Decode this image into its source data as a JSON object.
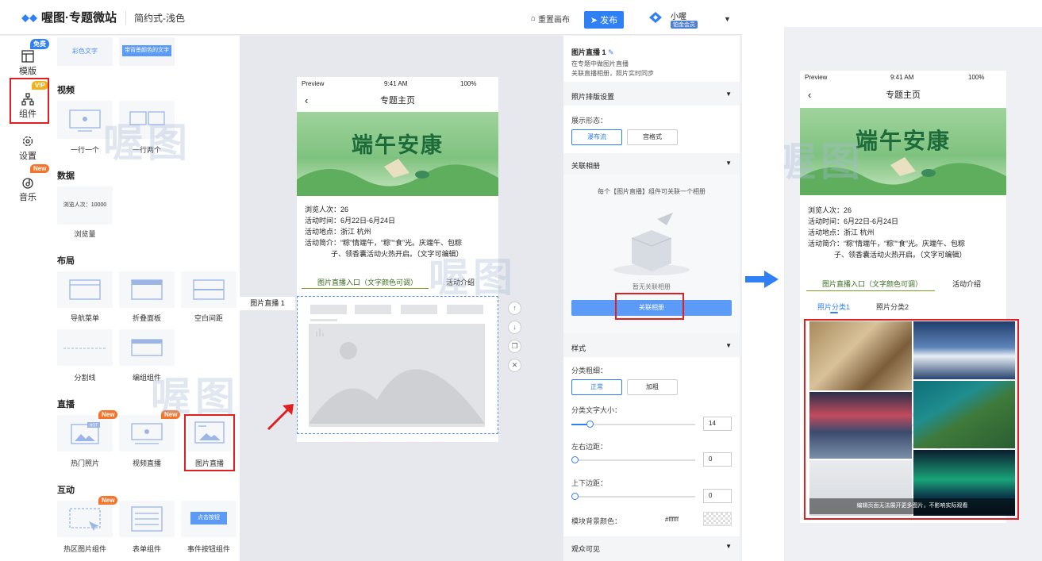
{
  "header": {
    "logo_text": "喔图·专题微站",
    "template_name": "简约式-浅色",
    "reset_label": "重置画布",
    "publish_label": "发布",
    "user_name": "小喔",
    "user_badge": "铂金会员"
  },
  "sidenav": {
    "items": [
      {
        "label": "模版",
        "badge": "免费",
        "badge_color": "#2f7ff5"
      },
      {
        "label": "组件",
        "badge": "VIP",
        "badge_color": "#f2b01e"
      },
      {
        "label": "设置",
        "badge": "",
        "badge_color": ""
      },
      {
        "label": "音乐",
        "badge": "New",
        "badge_color": "#f5742a"
      }
    ]
  },
  "components": {
    "top_cards": [
      "彩色文字",
      "带背景颜色的文字"
    ],
    "video": {
      "title": "视频",
      "items": [
        "一行一个",
        "一行两个"
      ]
    },
    "data": {
      "title": "数据",
      "items": [
        "浏览量"
      ],
      "card_text": "浏览人次：10000"
    },
    "layout": {
      "title": "布局",
      "items": [
        "导航菜单",
        "折叠面板",
        "空白间距",
        "分割线",
        "编组组件"
      ]
    },
    "live": {
      "title": "直播",
      "items": [
        "热门照片",
        "视频直播",
        "图片直播"
      ],
      "new_badge": "New",
      "hot_text": "HOT"
    },
    "interact": {
      "title": "互动",
      "items": [
        "热区图片组件",
        "表单组件",
        "事件按钮组件"
      ],
      "button_text": "点击按钮"
    }
  },
  "phone": {
    "status": {
      "carrier": "Preview",
      "time": "9:41 AM",
      "battery": "100%"
    },
    "title": "专题主页",
    "banner_title": "端午安康",
    "info": [
      "浏览人次：26",
      "活动时间：6月22日-6月24日",
      "活动地点：浙江 杭州",
      "活动简介：“粽”情端午，“粽”“食”光。庆端午、包粽",
      "子、领香囊活动火热开启。（文字可编辑）"
    ],
    "tabs": [
      "图片直播入口（文字颜色可调）",
      "活动介绍"
    ],
    "block_label": "图片直播 1"
  },
  "props": {
    "title": "图片直播 1",
    "desc1": "在专题中做图片直播",
    "desc2": "关联直播相册，照片实时同步",
    "sec_layout": "照片排版设置",
    "display_label": "展示形态：",
    "display_options": [
      "瀑布流",
      "宫格式"
    ],
    "sec_album": "关联相册",
    "album_hint": "每个【图片直播】组件可关联一个相册",
    "album_empty": "暂无关联相册",
    "album_button": "关联相册",
    "sec_style": "样式",
    "weight_label": "分类粗细：",
    "weight_options": [
      "正常",
      "加粗"
    ],
    "font_size_label": "分类文字大小：",
    "font_size_value": "14",
    "font_size_level": 0.15,
    "lr_label": "左右边距：",
    "lr_value": "0",
    "ud_label": "上下边距：",
    "ud_value": "0",
    "bg_label": "模块背景颜色：",
    "bg_value": "#ffffff",
    "sec_audience": "观众可见"
  },
  "preview": {
    "status": {
      "carrier": "Preview",
      "time": "9:41 AM",
      "battery": "100%"
    },
    "title": "专题主页",
    "banner_title": "端午安康",
    "info": [
      "浏览人次：26",
      "活动时间：6月22日-6月24日",
      "活动地点：浙江 杭州",
      "活动简介：“粽”情端午，“粽”“食”光。庆端午、包粽",
      "子、领香囊活动火热开启。（文字可编辑）"
    ],
    "tabs": [
      "图片直播入口（文字颜色可调）",
      "活动介绍"
    ],
    "categories": [
      "照片分类1",
      "照片分类2"
    ],
    "note": "编辑页面无法展开更多图片，不影响实际观看"
  },
  "watermark": "喔图",
  "colors": {
    "accent": "#2f7ff5",
    "highlight": "#e02020",
    "new_badge": "#f5742a"
  }
}
